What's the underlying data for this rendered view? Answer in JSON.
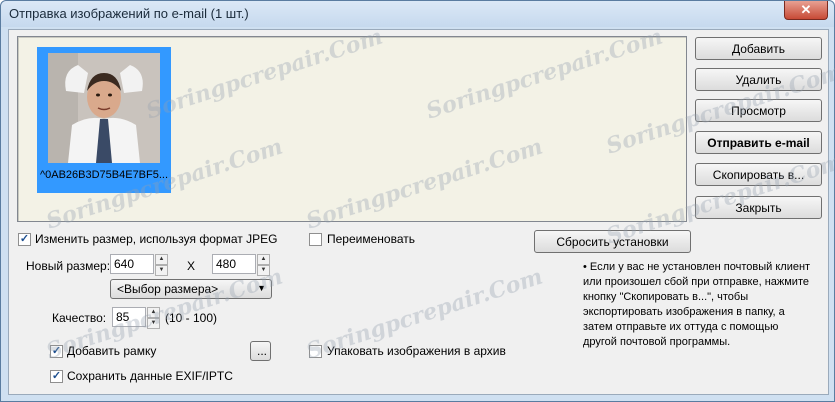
{
  "window": {
    "title": "Отправка изображений по e-mail (1 шт.)",
    "close_glyph": "✕"
  },
  "thumbnail": {
    "caption": "^0AB26B3D75B4E7BF5..."
  },
  "buttons": {
    "add": "Добавить",
    "delete": "Удалить",
    "preview": "Просмотр",
    "send": "Отправить e-mail",
    "copy": "Скопировать в...",
    "close": "Закрыть",
    "reset": "Сбросить установки",
    "ellipsis": "..."
  },
  "options": {
    "resize": {
      "label": "Изменить размер, используя формат JPEG",
      "checked": true
    },
    "rename": {
      "label": "Переименовать",
      "checked": false
    },
    "frame": {
      "label": "Добавить рамку",
      "checked": true
    },
    "exif": {
      "label": "Сохранить данные EXIF/IPTC",
      "checked": true
    },
    "archive": {
      "label": "Упаковать изображения в архив",
      "checked": false
    }
  },
  "size": {
    "label": "Новый размер:",
    "width": "640",
    "x_label": "X",
    "height": "480",
    "preset": "<Выбор размера>"
  },
  "quality": {
    "label": "Качество:",
    "value": "85",
    "range": "(10 - 100)"
  },
  "note": "• Если у вас не установлен почтовый клиент или произошел сбой при отправке, нажмите кнопку \"Скопировать в...\", чтобы экспортировать изображения в папку, а затем отправьте их оттуда с помощью другой почтовой программы.",
  "watermark": "Soringpcrepair.Com",
  "colors": {
    "selection": "#3399ff",
    "list_bg": "#f3f2e6",
    "title_bar": "#cfe0f1",
    "close": "#c74a36"
  }
}
